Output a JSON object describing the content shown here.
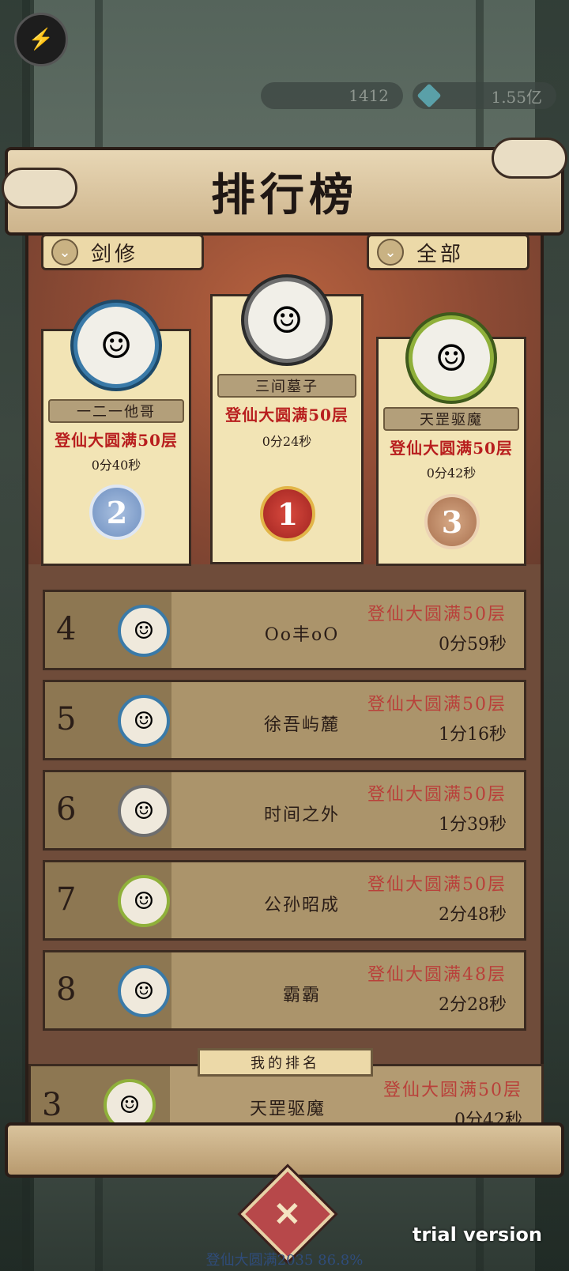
{
  "hud": {
    "resource1": "1412",
    "resource2": "1.55亿",
    "bottom_status": "登仙大圆满2035  86.8%",
    "watermark": "trial version"
  },
  "panel": {
    "title": "排行榜",
    "filter_left": "剑修",
    "filter_right": "全部"
  },
  "top3": [
    {
      "rank": "2",
      "name": "一二一他哥",
      "title": "登仙大圆满50层",
      "time": "0分40秒"
    },
    {
      "rank": "1",
      "name": "三间墓子",
      "title": "登仙大圆满50层",
      "time": "0分24秒"
    },
    {
      "rank": "3",
      "name": "天罡驱魔",
      "title": "登仙大圆满50层",
      "time": "0分42秒"
    }
  ],
  "rows": [
    {
      "rank": "4",
      "name": "Oo丰oO",
      "title": "登仙大圆满50层",
      "time": "0分59秒"
    },
    {
      "rank": "5",
      "name": "徐吾屿麓",
      "title": "登仙大圆满50层",
      "time": "1分16秒"
    },
    {
      "rank": "6",
      "name": "时间之外",
      "title": "登仙大圆满50层",
      "time": "1分39秒"
    },
    {
      "rank": "7",
      "name": "公孙昭成",
      "title": "登仙大圆满50层",
      "time": "2分48秒"
    },
    {
      "rank": "8",
      "name": "霸霸",
      "title": "登仙大圆满48层",
      "time": "2分28秒"
    }
  ],
  "my_rank": {
    "label": "我的排名",
    "rank": "3",
    "name": "天罡驱魔",
    "title": "登仙大圆满50层",
    "time": "0分42秒"
  },
  "icons": {
    "close": "✕",
    "chevron": "⌄",
    "avatar": "☺",
    "menu": "⚡"
  }
}
